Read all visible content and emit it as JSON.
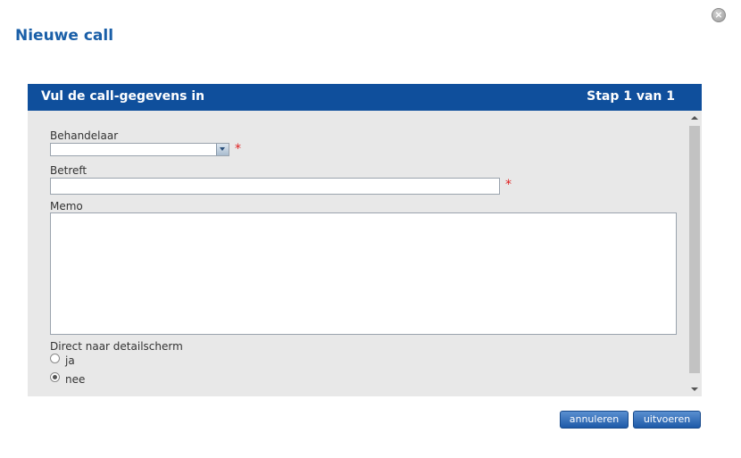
{
  "dialog": {
    "title": "Nieuwe call",
    "close_icon": "close-icon"
  },
  "wizard": {
    "header_title": "Vul de call-gegevens in",
    "step": "Stap 1 van 1",
    "header_color": "#0f4f9c"
  },
  "form": {
    "behandelaar_label": "Behandelaar",
    "behandelaar_value": "",
    "betreft_label": "Betreft",
    "betreft_value": "",
    "memo_label": "Memo",
    "memo_value": "",
    "required_marker": "*",
    "direct_label": "Direct naar detailscherm",
    "options": [
      {
        "label": "ja",
        "checked": false
      },
      {
        "label": "nee",
        "checked": true
      }
    ]
  },
  "buttons": {
    "cancel": "annuleren",
    "execute": "uitvoeren"
  }
}
